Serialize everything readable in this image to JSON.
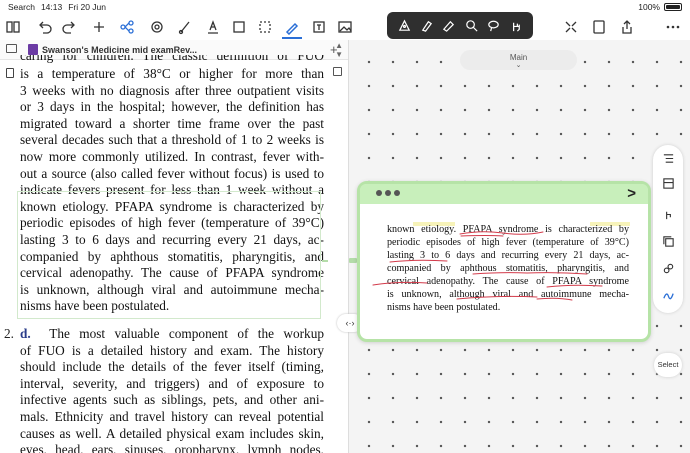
{
  "status": {
    "left": [
      "Search",
      "14:13",
      "Fri 20 Jun"
    ],
    "battery": "100%"
  },
  "doc": {
    "title": "Swanson's Medicine  mid examRev...",
    "lines_top": [
      "is a temperature of 38°C or higher for more than",
      "3 weeks with no diagnosis after three outpatient visits",
      "or 3 days in the hospital; however, the definition has",
      "migrated toward a shorter time frame over the past",
      "several decades such that a threshold of 1 to 2 weeks is",
      "now more commonly utilized. In contrast, fever with-",
      "out a source (also called fever without focus) is used to",
      "indicate fevers present for less than 1 week without a",
      "known etiology. PFAPA syndrome is characterized by",
      "periodic episodes of high fever (temperature of 39°C)",
      "lasting 3 to 6 days and recurring every 21 days, ac-",
      "companied by aphthous stomatitis, pharyngitis, and",
      "cervical adenopathy. The cause of PFAPA syndrome",
      "is unknown, although viral and autoimmune mecha-",
      "nisms have been postulated."
    ],
    "cut_line": "caring for children. The classic definition of FUO",
    "item_number": "2.",
    "item_letter": "d.",
    "lines_item": [
      "The most valuable component of the workup",
      "of FUO is a detailed history and exam. The history",
      "should include the details of the fever itself (timing,",
      "interval, severity, and triggers) and of exposure to",
      "infective agents such as siblings, pets, and other ani-",
      "mals. Ethnicity and travel history can reveal potential",
      "causes as well. A detailed physical exam includes skin,",
      "eyes, head, ears, sinuses, oropharynx, lymph nodes,"
    ]
  },
  "canvas": {
    "tab_label": "Main",
    "nav_toggle": "‹·›",
    "select_label": "Select",
    "card_lines": [
      "known etiology. PFAPA syndrome is characterized by",
      "periodic episodes of high fever (temperature of 39°C)",
      "lasting 3 to 6 days and recurring every 21 days, ac-",
      "companied by aphthous stomatitis, pharyngitis, and",
      "cervical adenopathy. The cause of PFAPA syndrome",
      "is unknown, although viral and autoimmune mecha-",
      "nisms have been postulated."
    ]
  },
  "colors": {
    "accent": "#2b6fd6",
    "card_border": "#b6e3a7",
    "card_header": "#c8efbb",
    "ink": "#d23a4a"
  }
}
